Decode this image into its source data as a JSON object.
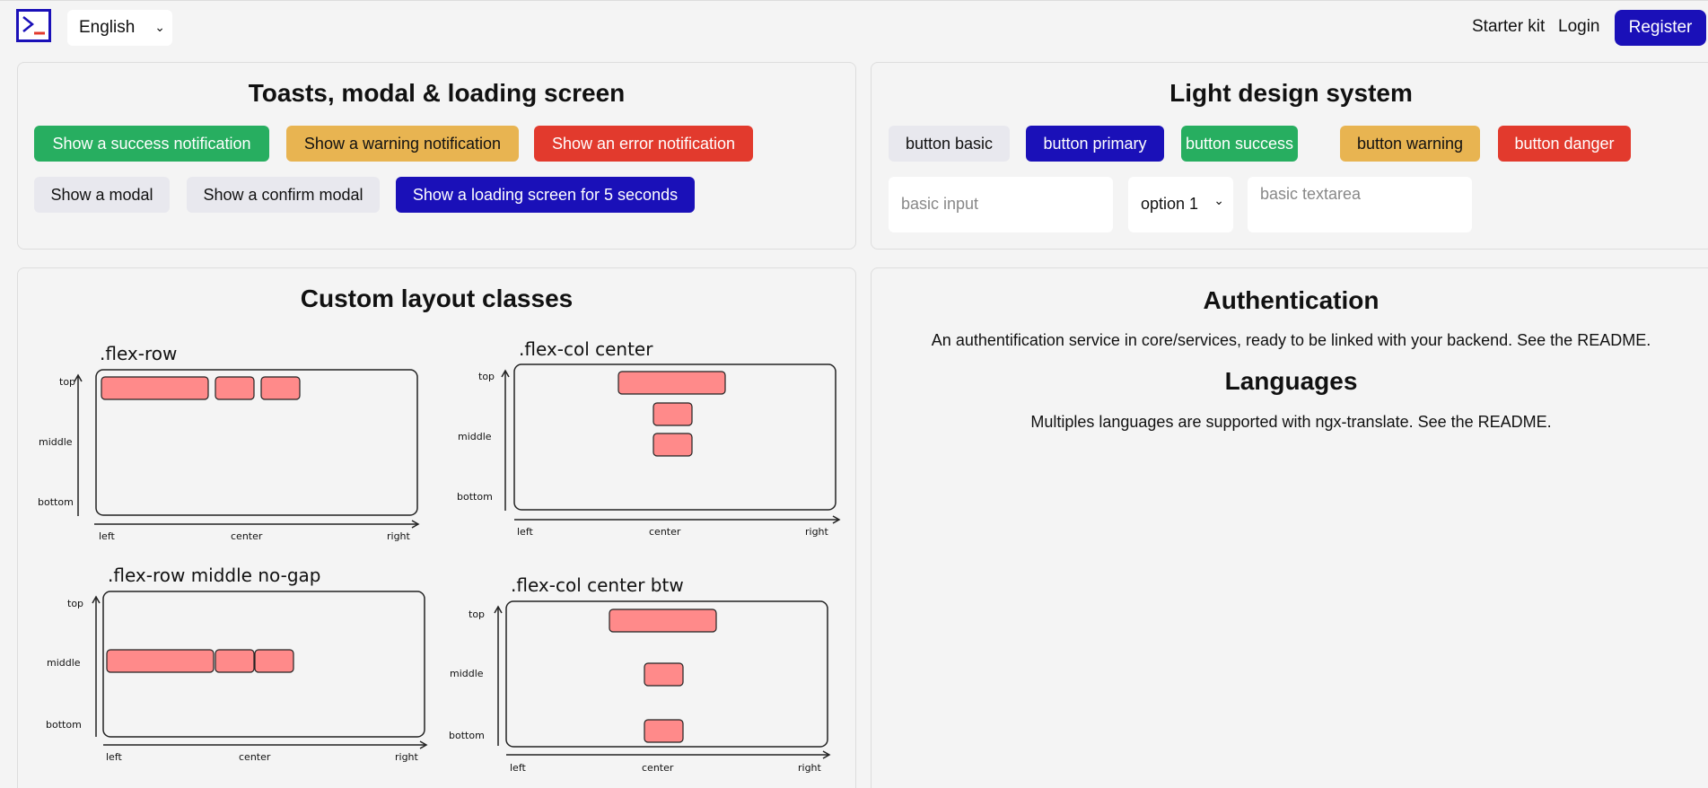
{
  "header": {
    "language": "English",
    "starter_kit": "Starter kit",
    "login": "Login",
    "register": "Register",
    "brand_color": "#1a10b8"
  },
  "toasts_card": {
    "title": "Toasts, modal & loading screen",
    "buttons": {
      "success": "Show a success notification",
      "warning": "Show a warning notification",
      "error": "Show an error notification",
      "modal": "Show a modal",
      "confirm": "Show a confirm modal",
      "loading": "Show a loading screen for 5 seconds"
    }
  },
  "design_card": {
    "title": "Light design system",
    "buttons": {
      "basic": "button basic",
      "primary": "button primary",
      "success": "button success",
      "warning": "button warning",
      "danger": "button danger"
    },
    "input_placeholder": "basic input",
    "select_value": "option 1",
    "textarea_placeholder": "basic textarea"
  },
  "layout_card": {
    "title": "Custom layout classes",
    "diagrams": [
      {
        "name": ".flex-row"
      },
      {
        "name": ".flex-col center"
      },
      {
        "name": ".flex-row middle no-gap"
      },
      {
        "name": ".flex-col center btw"
      }
    ],
    "axis": {
      "top": "top",
      "middle": "middle",
      "bottom": "bottom",
      "left": "left",
      "center": "center",
      "right": "right"
    }
  },
  "auth_card": {
    "title": "Authentication",
    "text": "An authentification service in core/services, ready to be linked with your backend. See the README.",
    "languages_title": "Languages",
    "languages_text": "Multiples languages are supported with ngx-translate. See the README."
  },
  "colors": {
    "success": "#27ae60",
    "warning": "#e8b451",
    "danger": "#e23a2d",
    "primary": "#1a10b8",
    "block": "#ff8a8a"
  }
}
